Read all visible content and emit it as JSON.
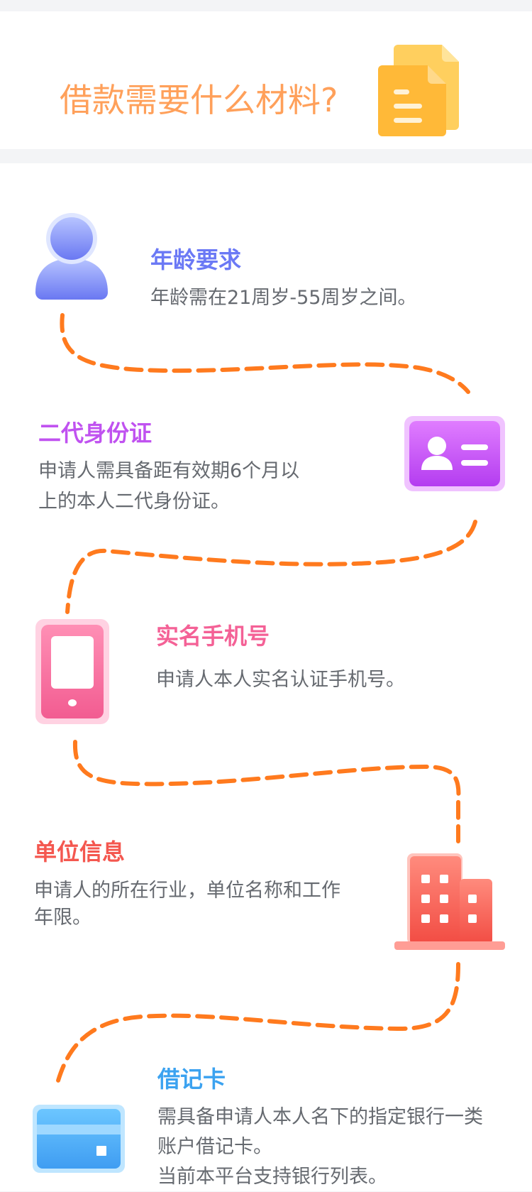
{
  "header": {
    "title": "借款需要什么材料?",
    "icon": "document-icon",
    "title_color": "#ffa05a",
    "icon_color": "#ffc14a"
  },
  "items": [
    {
      "title": "年龄要求",
      "desc": [
        "年龄需在21周岁-55周岁之间。"
      ],
      "icon": "user-icon",
      "color": "#6b79f5"
    },
    {
      "title": "二代身份证",
      "desc": [
        "申请人需具备距有效期6个月以",
        "上的本人二代身份证。"
      ],
      "icon": "id-card-icon",
      "color": "#c052f0"
    },
    {
      "title": "实名手机号",
      "desc": [
        "申请人本人实名认证手机号。"
      ],
      "icon": "phone-icon",
      "color": "#f46196"
    },
    {
      "title": "单位信息",
      "desc": [
        "申请人的所在行业，单位名称和工作",
        "年限。"
      ],
      "icon": "building-icon",
      "color": "#f4574f"
    },
    {
      "title": "借记卡",
      "desc": [
        "需具备申请人本人名下的指定银行一类",
        "账户借记卡。",
        "当前本平台支持银行列表。"
      ],
      "icon": "bank-card-icon",
      "color": "#3ba2f0"
    }
  ],
  "path_color": "#ff7a1e"
}
